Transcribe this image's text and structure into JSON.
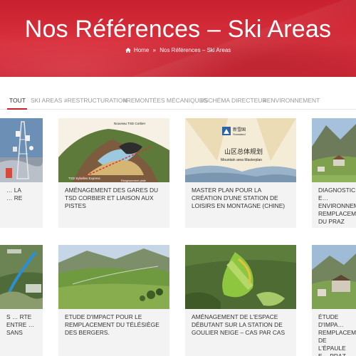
{
  "header": {
    "title": "Nos Références – Ski Areas",
    "breadcrumb": {
      "home": "Home",
      "separator": "»",
      "current": "Nos Références – Ski Areas"
    }
  },
  "filters": [
    {
      "label": "TOUT",
      "active": true
    },
    {
      "label": "SKI AREAS",
      "active": false
    },
    {
      "label": "#RESTRUCTURATION",
      "active": false
    },
    {
      "label": "#REMONTÉES MÉCANIQUES",
      "active": false
    },
    {
      "label": "#SCHÉMA DIRECTEUR",
      "active": false
    },
    {
      "label": "#ENVIRONNEMENT",
      "active": false
    }
  ],
  "cards": [
    {
      "title": "… la\n… re",
      "image": "antenna-tower"
    },
    {
      "title": "AMÉNAGEMENT DES GARES DU TSD CORBIER ET LIAISON AUX PISTES",
      "image": "mountain-3d-model",
      "labels": {
        "top": "Nouveau TSD Corbier",
        "left": "TSD Sybelles Express",
        "bottom": "Elargissement piste"
      }
    },
    {
      "title": "MASTER PLAN POUR LA CRÉATION D'UNE STATION DE LOISIRS EN MONTAGNE (CHINE)",
      "image": "snowland-masterplan",
      "labels": {
        "logo_cn": "新雪国",
        "logo_en": "Snowland",
        "heading_cn": "山区总体规划",
        "heading_en": "Mountain area Masterplan"
      }
    },
    {
      "title": "DIAGNOSTIC E… ENVIRONNEME… REMPLACEME… DU PRAZ",
      "image": "alpine-village"
    },
    {
      "title": "S … RTE ENTRE … SANS",
      "image": "aerial-route-map"
    },
    {
      "title": "ETUDE D'IMPACT POUR LE REMPLACEMENT DU TÉLÉSIÈGE DES BERGERS.",
      "image": "green-valley"
    },
    {
      "title": "AMÉNAGEMENT DE L'ESPACE DÉBUTANT SUR LA STATION DE GOULIER NEIGE – CAS PAR CAS",
      "image": "beginner-area-plan"
    },
    {
      "title": "ÉTUDE D'IMPA… REMPLACEME… DE L'ÉPAULE E… PRAZ DE LYS",
      "image": "resort-buildings"
    }
  ]
}
